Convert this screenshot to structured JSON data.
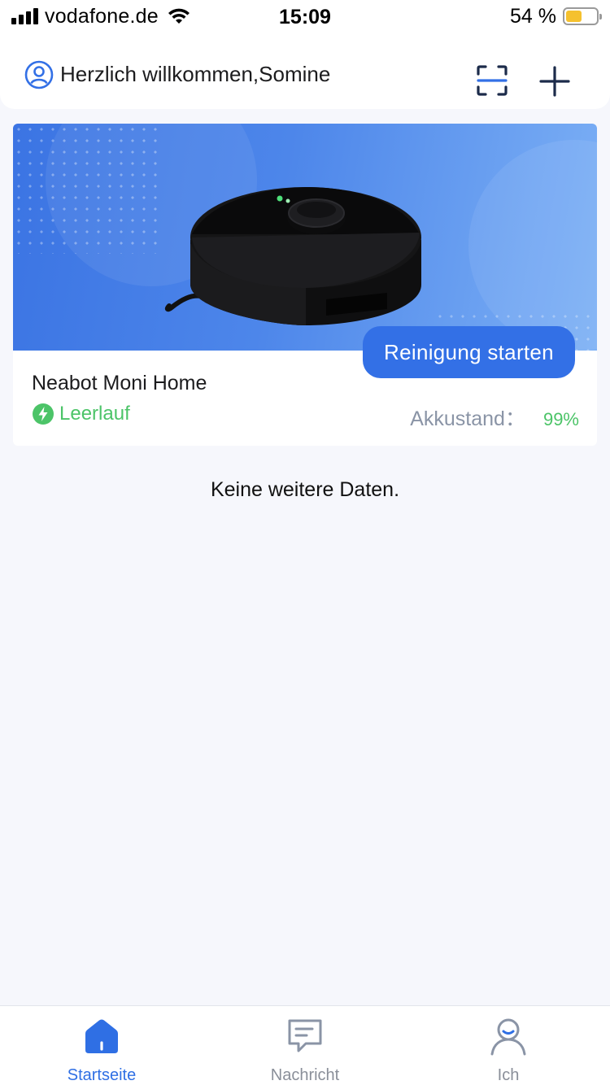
{
  "status_bar": {
    "carrier": "vodafone.de",
    "time": "15:09",
    "battery_percent_text": "54 %",
    "battery_level": 0.54
  },
  "header": {
    "welcome_text": "Herzlich willkommen,Somine",
    "icons": [
      "user-icon",
      "scan-icon",
      "plus-icon"
    ]
  },
  "device": {
    "name": "Neabot Moni Home",
    "status": "Leerlauf",
    "battery_label": "Akkustand",
    "battery_separator": "：",
    "battery_value": "99%",
    "start_button": "Reinigung starten"
  },
  "list_footer": "Keine weitere Daten.",
  "tabbar": {
    "tabs": [
      {
        "label": "Startseite",
        "icon": "home-icon",
        "active": true
      },
      {
        "label": "Nachricht",
        "icon": "message-icon",
        "active": false
      },
      {
        "label": "Ich",
        "icon": "profile-icon",
        "active": false
      }
    ]
  },
  "colors": {
    "accent": "#3370e6",
    "status_green": "#4cc468",
    "background": "#f6f7fc"
  }
}
